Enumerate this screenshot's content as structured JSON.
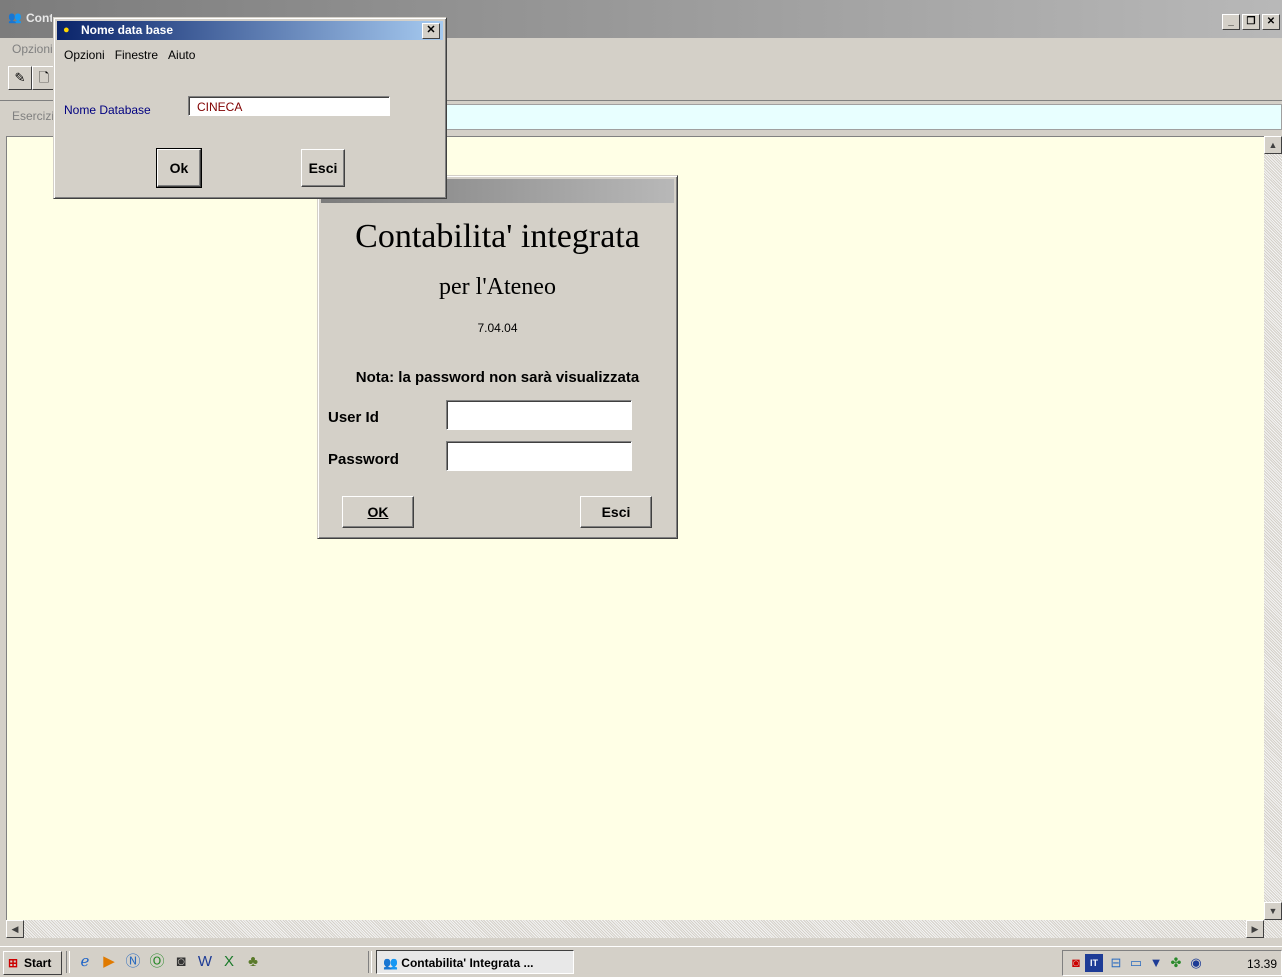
{
  "main_window": {
    "title": "Contabilita' integrata",
    "menu_label": "Opzioni",
    "info_label": "Esercizio"
  },
  "db_dialog": {
    "title": "Nome data base",
    "menu": [
      "Opzioni",
      "Finestre",
      "Aiuto"
    ],
    "field_label": "Nome Database",
    "field_value": "CINECA",
    "ok_label": "Ok",
    "exit_label": "Esci"
  },
  "login_dialog": {
    "heading": "Contabilita' integrata",
    "subheading": "per l'Ateneo",
    "version": "7.04.04",
    "note": "Nota: la password non sarà visualizzata",
    "userid_label": "User Id",
    "password_label": "Password",
    "userid_value": "",
    "password_value": "",
    "ok_label": "OK",
    "exit_label": "Esci"
  },
  "taskbar": {
    "start_label": "Start",
    "task_label": "Contabilita' Integrata ...",
    "clock": "13.39",
    "tray_lang": "IT"
  }
}
